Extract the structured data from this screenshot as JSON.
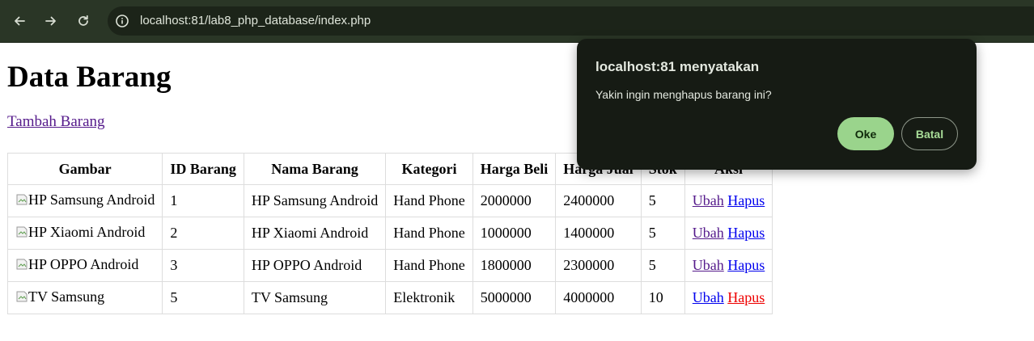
{
  "browser": {
    "url": "localhost:81/lab8_php_database/index.php",
    "icons": {
      "back": "back-arrow-icon",
      "forward": "forward-arrow-icon",
      "reload": "reload-icon",
      "site_info": "info-icon"
    }
  },
  "page": {
    "title": "Data Barang",
    "add_link": "Tambah Barang"
  },
  "table": {
    "headers": [
      "Gambar",
      "ID Barang",
      "Nama Barang",
      "Kategori",
      "Harga Beli",
      "Harga Jual",
      "Stok",
      "Aksi"
    ],
    "rows": [
      {
        "gambar": "HP Samsung Android",
        "id": "1",
        "nama": "HP Samsung Android",
        "kategori": "Hand Phone",
        "harga_beli": "2000000",
        "harga_jual": "2400000",
        "stok": "5",
        "ubah": "Ubah",
        "hapus": "Hapus"
      },
      {
        "gambar": "HP Xiaomi Android",
        "id": "2",
        "nama": "HP Xiaomi Android",
        "kategori": "Hand Phone",
        "harga_beli": "1000000",
        "harga_jual": "1400000",
        "stok": "5",
        "ubah": "Ubah",
        "hapus": "Hapus"
      },
      {
        "gambar": "HP OPPO Android",
        "id": "3",
        "nama": "HP OPPO Android",
        "kategori": "Hand Phone",
        "harga_beli": "1800000",
        "harga_jual": "2300000",
        "stok": "5",
        "ubah": "Ubah",
        "hapus": "Hapus"
      },
      {
        "gambar": "TV Samsung",
        "id": "5",
        "nama": "TV Samsung",
        "kategori": "Elektronik",
        "harga_beli": "5000000",
        "harga_jual": "4000000",
        "stok": "10",
        "ubah": "Ubah",
        "hapus": "Hapus"
      }
    ]
  },
  "dialog": {
    "title": "localhost:81 menyatakan",
    "message": "Yakin ingin menghapus barang ini?",
    "ok_label": "Oke",
    "cancel_label": "Batal"
  },
  "colors": {
    "toolbar_bg": "#2a3626",
    "dialog_bg": "#161b14",
    "ok_button": "#9ad48c",
    "link_visited": "#551a8b",
    "link": "#0000ee",
    "link_active": "#ee0000"
  }
}
